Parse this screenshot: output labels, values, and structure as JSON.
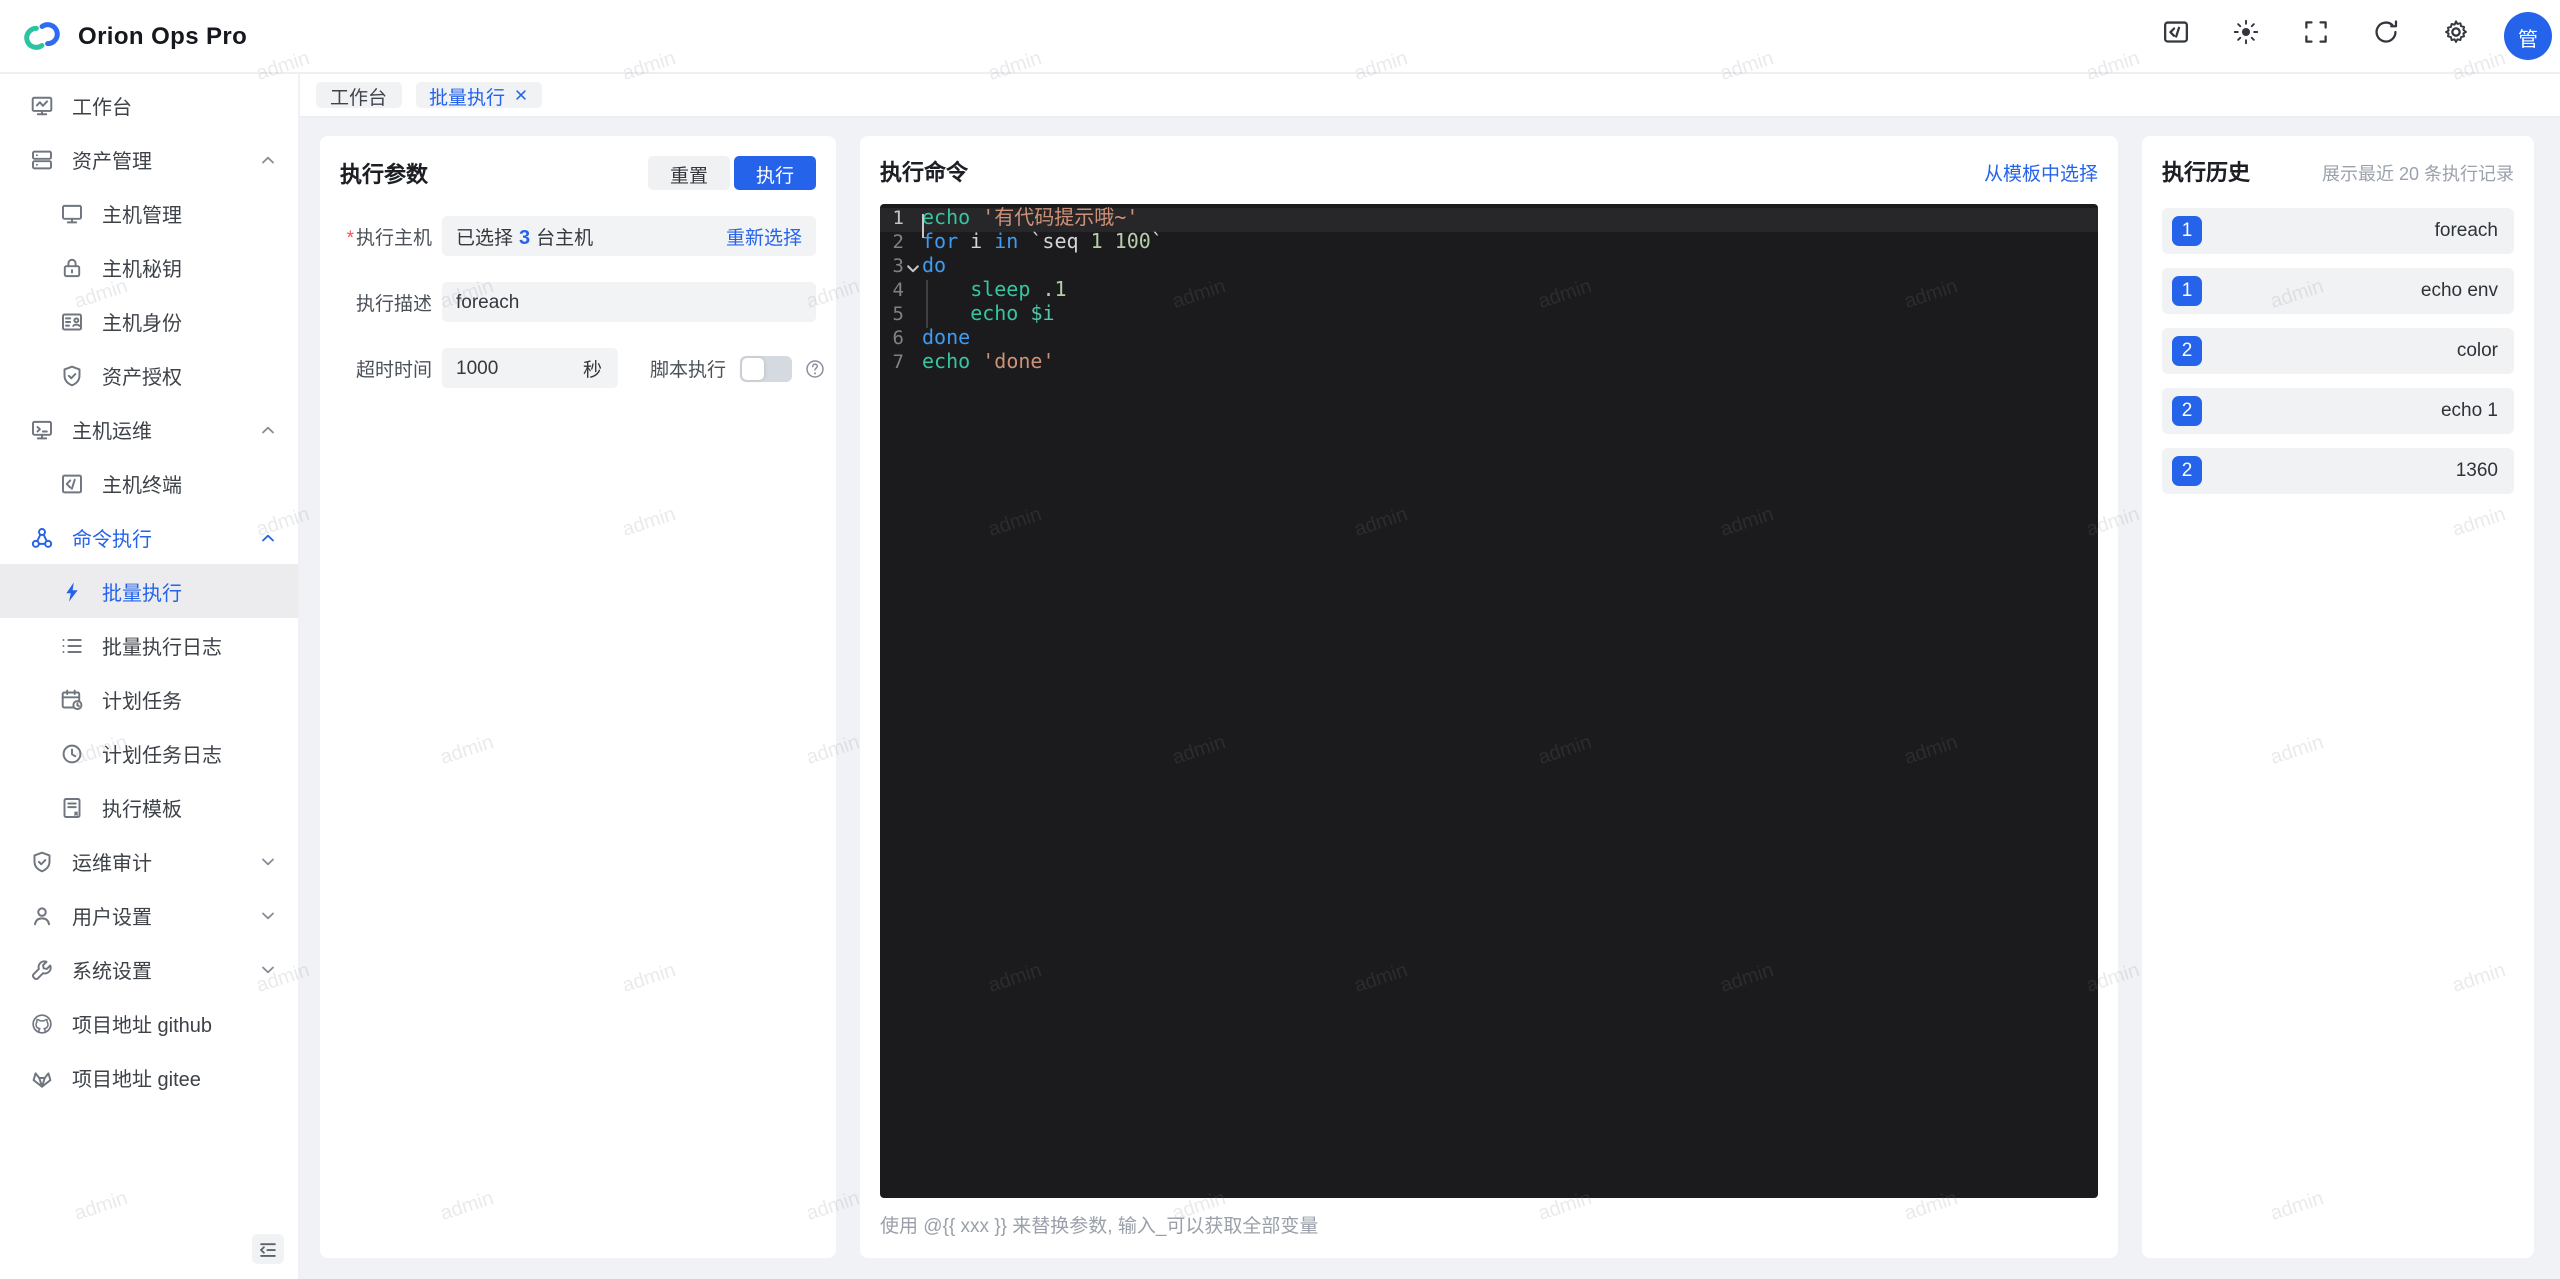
{
  "app": {
    "name": "Orion Ops Pro",
    "logo_icon": "logo-icon"
  },
  "header": {
    "actions": [
      {
        "icon": "terminal-window-icon"
      },
      {
        "icon": "theme-toggle-icon"
      },
      {
        "icon": "fullscreen-icon"
      },
      {
        "icon": "refresh-icon"
      },
      {
        "icon": "settings-gear-icon"
      }
    ],
    "avatar_text": "管"
  },
  "tabs": [
    {
      "label": "工作台"
    },
    {
      "label": "批量执行",
      "active": true,
      "close_icon": "close-icon"
    }
  ],
  "sidebar": {
    "items": [
      {
        "label": "工作台",
        "icon": "workbench-icon"
      },
      {
        "label": "资产管理",
        "icon": "asset-management-icon",
        "chevron_icon": "chevron-up-icon"
      },
      {
        "label": "主机管理",
        "icon": "host-monitor-icon",
        "child": true
      },
      {
        "label": "主机秘钥",
        "icon": "host-key-icon",
        "child": true
      },
      {
        "label": "主机身份",
        "icon": "host-identity-icon",
        "child": true
      },
      {
        "label": "资产授权",
        "icon": "asset-auth-icon",
        "child": true
      },
      {
        "label": "主机运维",
        "icon": "host-ops-icon",
        "chevron_icon": "chevron-up-icon"
      },
      {
        "label": "主机终端",
        "icon": "host-terminal-icon",
        "child": true
      },
      {
        "label": "命令执行",
        "icon": "command-exec-icon",
        "chevron_icon": "chevron-up-icon",
        "highlight": true
      },
      {
        "label": "批量执行",
        "icon": "batch-exec-icon",
        "child": true,
        "active": true
      },
      {
        "label": "批量执行日志",
        "icon": "batch-log-icon",
        "child": true
      },
      {
        "label": "计划任务",
        "icon": "cron-task-icon",
        "child": true
      },
      {
        "label": "计划任务日志",
        "icon": "cron-log-icon",
        "child": true
      },
      {
        "label": "执行模板",
        "icon": "exec-template-icon",
        "child": true
      },
      {
        "label": "运维审计",
        "icon": "audit-shield-icon",
        "chevron_icon": "chevron-down-icon"
      },
      {
        "label": "用户设置",
        "icon": "user-settings-icon",
        "chevron_icon": "chevron-down-icon"
      },
      {
        "label": "系统设置",
        "icon": "system-settings-icon",
        "chevron_icon": "chevron-down-icon"
      },
      {
        "label": "项目地址 github",
        "icon": "github-icon"
      },
      {
        "label": "项目地址 gitee",
        "icon": "gitee-icon"
      }
    ],
    "collapse_icon": "collapse-sidebar-icon"
  },
  "params_panel": {
    "title": "执行参数",
    "reset_button": "重置",
    "execute_button": "执行",
    "required_mark": "*",
    "host": {
      "label": "执行主机",
      "required": true,
      "prefix": "已选择",
      "count": "3",
      "suffix": "台主机",
      "reselect": "重新选择"
    },
    "description": {
      "label": "执行描述",
      "value": "foreach"
    },
    "timeout": {
      "label": "超时时间",
      "value": "1000",
      "unit": "秒"
    },
    "script_mode": {
      "label": "脚本执行",
      "enabled": false,
      "help_icon": "question-circle-icon"
    }
  },
  "command_panel": {
    "title": "执行命令",
    "template_link": "从模板中选择",
    "hint": "使用 @{{ xxx }} 来替换参数, 输入_可以获取全部变量",
    "editor": {
      "language": "shell",
      "lines": [
        {
          "num": "1",
          "current": true,
          "tokens": [
            {
              "text": "echo",
              "cls": "fn"
            },
            {
              "text": " ",
              "cls": "pl"
            },
            {
              "text": "'有代码提示哦~'",
              "cls": "str"
            }
          ]
        },
        {
          "num": "2",
          "tokens": [
            {
              "text": "for",
              "cls": "kw"
            },
            {
              "text": " i ",
              "cls": "pl"
            },
            {
              "text": "in",
              "cls": "kw"
            },
            {
              "text": " `seq ",
              "cls": "pl"
            },
            {
              "text": "1 100",
              "cls": "num"
            },
            {
              "text": "`",
              "cls": "pl"
            }
          ]
        },
        {
          "num": "3",
          "fold_icon": "fold-open-icon",
          "tokens": [
            {
              "text": "do",
              "cls": "kw"
            }
          ]
        },
        {
          "num": "4",
          "guide": true,
          "tokens": [
            {
              "text": "    ",
              "cls": "pl"
            },
            {
              "text": "sleep",
              "cls": "fn"
            },
            {
              "text": " ",
              "cls": "pl"
            },
            {
              "text": ".1",
              "cls": "num"
            }
          ]
        },
        {
          "num": "5",
          "guide": true,
          "tokens": [
            {
              "text": "    ",
              "cls": "pl"
            },
            {
              "text": "echo",
              "cls": "fn"
            },
            {
              "text": " ",
              "cls": "pl"
            },
            {
              "text": "$i",
              "cls": "var"
            }
          ]
        },
        {
          "num": "6",
          "tokens": [
            {
              "text": "done",
              "cls": "kw"
            }
          ]
        },
        {
          "num": "7",
          "tokens": [
            {
              "text": "echo",
              "cls": "fn"
            },
            {
              "text": " ",
              "cls": "pl"
            },
            {
              "text": "'done'",
              "cls": "str"
            }
          ]
        }
      ]
    }
  },
  "history_panel": {
    "title": "执行历史",
    "subtitle": "展示最近 20 条执行记录",
    "items": [
      {
        "badge": "1",
        "label": "foreach"
      },
      {
        "badge": "1",
        "label": "echo env"
      },
      {
        "badge": "2",
        "label": "color"
      },
      {
        "badge": "2",
        "label": "echo 1"
      },
      {
        "badge": "2",
        "label": "1360"
      }
    ]
  },
  "watermark": {
    "text": "admin"
  },
  "colors": {
    "primary": "#2563eb",
    "logo_teal": "#2cc3a0",
    "logo_blue": "#2d6cf0",
    "editor_bg": "#1b1b1d",
    "page_bg": "#f0f2f5"
  }
}
